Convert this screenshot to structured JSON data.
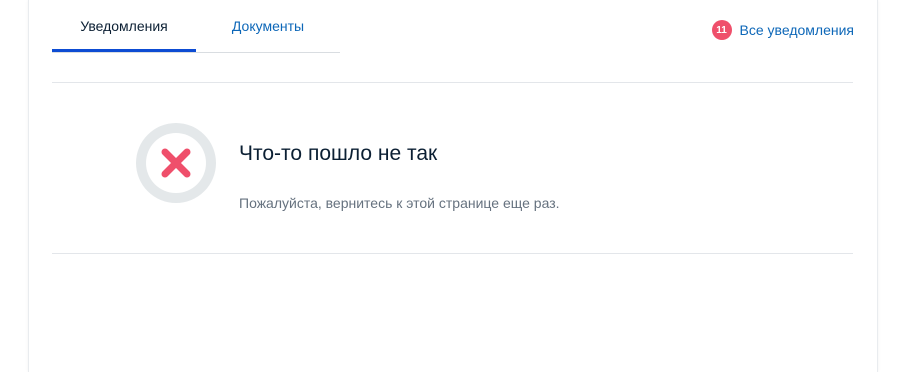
{
  "tabs": [
    {
      "label": "Уведомления",
      "active": true
    },
    {
      "label": "Документы",
      "active": false
    }
  ],
  "notifications_link": {
    "count": "11",
    "label": "Все уведомления"
  },
  "error": {
    "icon": "close-icon",
    "title": "Что-то пошло не так",
    "message": "Пожалуйста, вернитесь к этой странице еще раз."
  },
  "colors": {
    "accent": "#0d4cd3",
    "link": "#0d67b8",
    "badge": "#ef4f6b",
    "error_icon": "#ef4f6b"
  }
}
